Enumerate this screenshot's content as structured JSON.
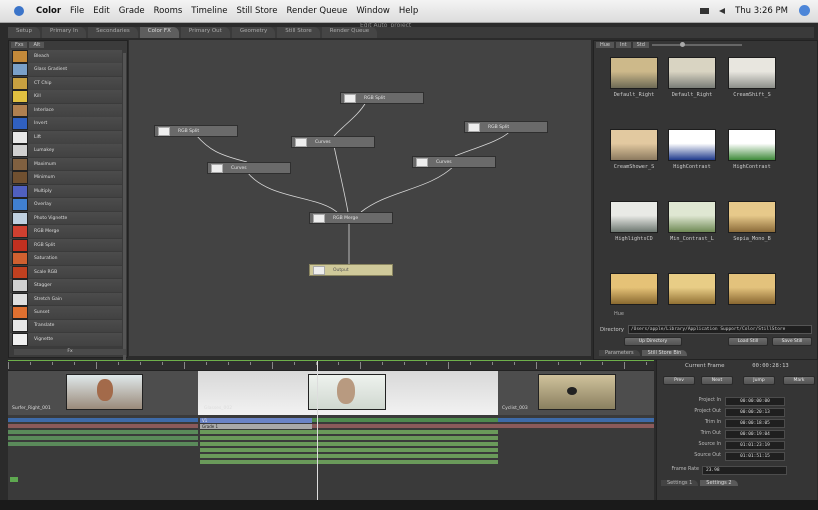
{
  "menubar": {
    "app_name": "Color",
    "menus": [
      "File",
      "Edit",
      "Grade",
      "Rooms",
      "Timeline",
      "Still Store",
      "Render Queue",
      "Window",
      "Help"
    ],
    "clock": "Thu 3:26 PM"
  },
  "window_title": "Edit Auto_project",
  "rooms": [
    {
      "label": "Setup",
      "active": false
    },
    {
      "label": "Primary In",
      "active": false
    },
    {
      "label": "Secondaries",
      "active": false
    },
    {
      "label": "Color FX",
      "active": true
    },
    {
      "label": "Primary Out",
      "active": false
    },
    {
      "label": "Geometry",
      "active": false
    },
    {
      "label": "Still Store",
      "active": false
    },
    {
      "label": "Render Queue",
      "active": false
    }
  ],
  "node_list": {
    "tabs": [
      "Fxs",
      "Alt"
    ],
    "items": [
      {
        "label": "Bleach",
        "color": "#c48a3a"
      },
      {
        "label": "Glass Gradient",
        "color": "#7aa0c8"
      },
      {
        "label": "CT Chip",
        "color": "#c8a040"
      },
      {
        "label": "Kill",
        "color": "#e0c040"
      },
      {
        "label": "Interlace",
        "color": "#b08050"
      },
      {
        "label": "Invert",
        "color": "#3060c0"
      },
      {
        "label": "Lift",
        "color": "#e8e8e8"
      },
      {
        "label": "Lumakey",
        "color": "#d0d0d0"
      },
      {
        "label": "Maximum",
        "color": "#806040"
      },
      {
        "label": "Minimum",
        "color": "#705030"
      },
      {
        "label": "Multiply",
        "color": "#5060c0"
      },
      {
        "label": "Overlay",
        "color": "#4080d0"
      },
      {
        "label": "Photo Vignette",
        "color": "#c0d0e0"
      },
      {
        "label": "RGB Merge",
        "color": "#d04030"
      },
      {
        "label": "RGB Split",
        "color": "#c03020"
      },
      {
        "label": "Saturation",
        "color": "#d06030"
      },
      {
        "label": "Scale RGB",
        "color": "#c04020"
      },
      {
        "label": "Stagger",
        "color": "#d0d0d0"
      },
      {
        "label": "Stretch Gain",
        "color": "#e0e0e0"
      },
      {
        "label": "Sunset",
        "color": "#e07030"
      },
      {
        "label": "Translate",
        "color": "#e8e8e8"
      },
      {
        "label": "Vignette",
        "color": "#f0f0f0"
      }
    ],
    "footer": "Fx"
  },
  "graph_nodes": [
    {
      "id": "split1",
      "label": "RGB Split"
    },
    {
      "id": "split2",
      "label": "RGB Split"
    },
    {
      "id": "split3",
      "label": "RGB Split"
    },
    {
      "id": "curves1",
      "label": "Curves"
    },
    {
      "id": "curves2",
      "label": "Curves"
    },
    {
      "id": "curves3",
      "label": "Curves"
    },
    {
      "id": "merge",
      "label": "RGB Merge"
    },
    {
      "id": "output",
      "label": "Output"
    }
  ],
  "still_store": {
    "tabs": [
      "Hue",
      "Int",
      "Std"
    ],
    "stills": [
      {
        "caption": "Default_Right",
        "tone": [
          "#cdb98a",
          "#6d6a55"
        ]
      },
      {
        "caption": "Default_Right",
        "tone": [
          "#d9d4c2",
          "#7a7d78"
        ]
      },
      {
        "caption": "CreamShift_S",
        "tone": [
          "#e8e6df",
          "#8d8f8a"
        ]
      },
      {
        "caption": "CreamShower_S",
        "tone": [
          "#e2c9a0",
          "#8c7a5f"
        ]
      },
      {
        "caption": "HighContrast",
        "tone": [
          "#ffffff",
          "#1f3a8c"
        ]
      },
      {
        "caption": "HighContrast",
        "tone": [
          "#ffffff",
          "#3f8a3a"
        ]
      },
      {
        "caption": "HighlightsCD",
        "tone": [
          "#e9eae6",
          "#6d7770"
        ]
      },
      {
        "caption": "Min_Contrast_L",
        "tone": [
          "#dfe7d2",
          "#6f8a55"
        ]
      },
      {
        "caption": "Sepia_Mono_B",
        "tone": [
          "#e7c98a",
          "#8c6c3a"
        ]
      },
      {
        "caption": "",
        "tone": [
          "#e5c277",
          "#8a6a30"
        ]
      },
      {
        "caption": "",
        "tone": [
          "#e8cd86",
          "#927134"
        ]
      },
      {
        "caption": "",
        "tone": [
          "#e3c27c",
          "#896731"
        ]
      }
    ],
    "grid_label": "Hue",
    "directory_label": "Directory",
    "directory_value": "/Users/apple/Library/Application Support/Color/StillStore",
    "up_button": "Up Directory",
    "load_button": "Load Still",
    "save_button": "Save Still",
    "subtabs": [
      {
        "label": "Parameters",
        "active": false
      },
      {
        "label": "Still Store Bin",
        "active": true
      }
    ]
  },
  "timeline": {
    "clip_names": [
      "Surfer_Right_001",
      "Glasses_002",
      "Cyclist_003"
    ],
    "tracks_labels": [
      "V1",
      "Grade 1"
    ]
  },
  "shot_info": {
    "current_frame_label": "Current Frame",
    "current_frame_value": "00:00:28:13",
    "buttons": [
      "Prev",
      "Next",
      "Jump",
      "Mark"
    ],
    "fields": [
      {
        "label": "Project In",
        "value": "00:00:00:00"
      },
      {
        "label": "Project Out",
        "value": "00:00:20:13"
      },
      {
        "label": "Trim In",
        "value": "00:00:18:05"
      },
      {
        "label": "Trim Out",
        "value": "00:00:19:04"
      },
      {
        "label": "Source In",
        "value": "01:01:23:19"
      },
      {
        "label": "Source Out",
        "value": "01:01:51:15"
      }
    ],
    "frame_rate_label": "Frame Rate",
    "frame_rate_value": "23.98",
    "tabs": [
      {
        "label": "Settings 1",
        "active": false
      },
      {
        "label": "Settings 2",
        "active": true
      }
    ]
  }
}
